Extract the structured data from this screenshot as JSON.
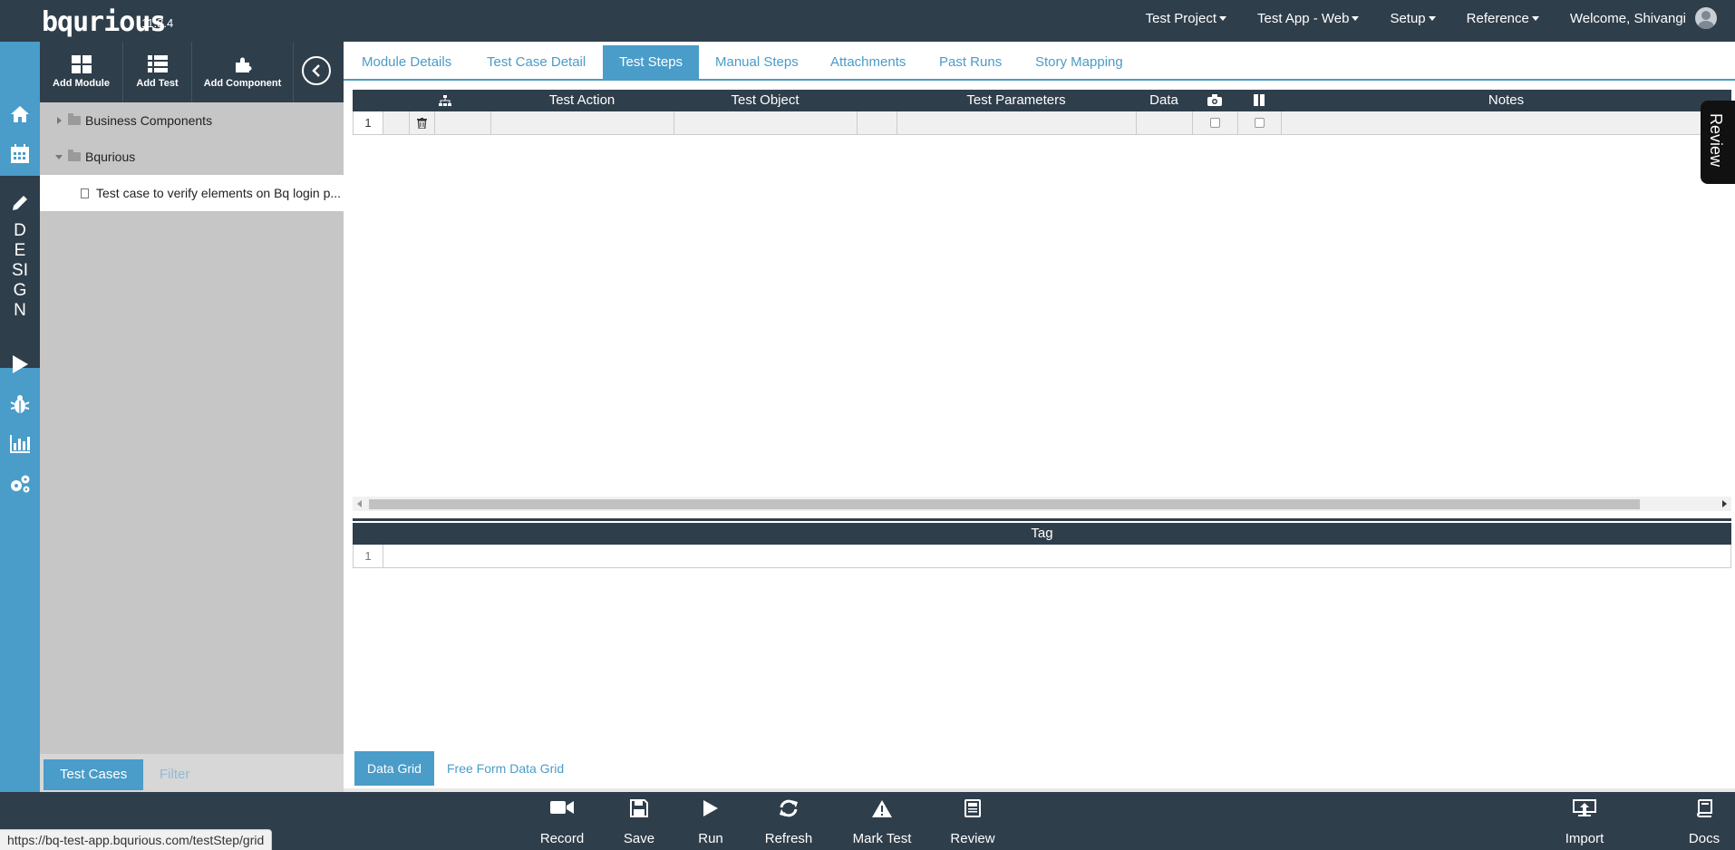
{
  "app": {
    "logo": "bqurious",
    "version": "11.8.4"
  },
  "topnav": {
    "project": "Test Project",
    "app": "Test App - Web",
    "setup": "Setup",
    "reference": "Reference",
    "welcome": "Welcome, Shivangi"
  },
  "rail": {
    "design_label": [
      "D",
      "E",
      "SI",
      "G",
      "N"
    ]
  },
  "sidebar": {
    "toolbar": {
      "add_module": "Add Module",
      "add_test": "Add Test",
      "add_component": "Add Component"
    },
    "tree": [
      {
        "label": "Business Components"
      },
      {
        "label": "Bqurious"
      },
      {
        "label": "Test case to verify elements on Bq login p..."
      }
    ],
    "tabs": {
      "test_cases": "Test Cases",
      "filter": "Filter"
    }
  },
  "main": {
    "tabs": [
      "Module Details",
      "Test Case Detail",
      "Test Steps",
      "Manual Steps",
      "Attachments",
      "Past Runs",
      "Story Mapping"
    ],
    "grid": {
      "headers": {
        "test_action": "Test Action",
        "test_object": "Test Object",
        "test_parameters": "Test Parameters",
        "data": "Data",
        "notes": "Notes"
      },
      "row_number": "1"
    },
    "tag_grid": {
      "header": "Tag",
      "row_number": "1"
    },
    "bottom_tabs": {
      "data_grid": "Data Grid",
      "free_form": "Free Form Data Grid"
    }
  },
  "review_tab": "Review",
  "actions": {
    "record": "Record",
    "save": "Save",
    "run": "Run",
    "refresh": "Refresh",
    "mark_test": "Mark Test",
    "review": "Review",
    "import": "Import",
    "docs": "Docs"
  },
  "status_url": "https://bq-test-app.bqurious.com/testStep/grid",
  "colors": {
    "dark": "#2f3e4b",
    "accent": "#4a9cc9",
    "sidebar": "#c6c6c6"
  }
}
